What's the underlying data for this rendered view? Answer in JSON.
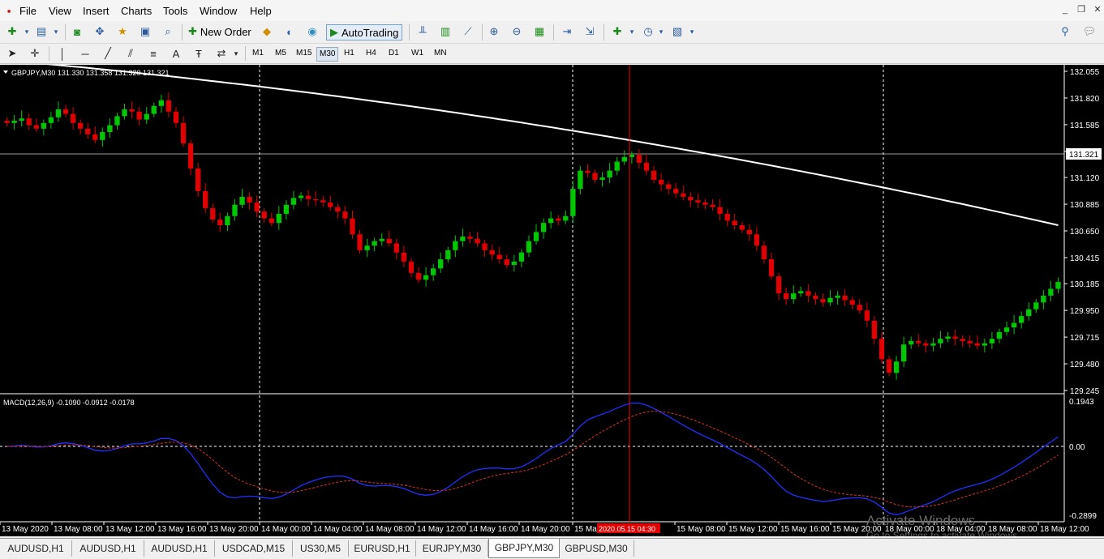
{
  "menu": [
    "File",
    "View",
    "Insert",
    "Charts",
    "Tools",
    "Window",
    "Help"
  ],
  "toolbar": {
    "new_order": "New Order",
    "autotrading": "AutoTrading"
  },
  "timeframes": [
    "M1",
    "M5",
    "M15",
    "M30",
    "H1",
    "H4",
    "D1",
    "W1",
    "MN"
  ],
  "active_timeframe": "M30",
  "chart": {
    "info": "GBPJPY,M30  131.330 131.358 131.320 131.321",
    "current_price": "131.321",
    "price_ticks": [
      "132.055",
      "131.820",
      "131.585",
      "131.350",
      "131.120",
      "130.885",
      "130.650",
      "130.415",
      "130.185",
      "129.950",
      "129.715",
      "129.480",
      "129.245"
    ],
    "time_labels": [
      "13 May 2020",
      "13 May 08:00",
      "13 May 12:00",
      "13 May 16:00",
      "13 May 20:00",
      "14 May 00:00",
      "14 May 04:00",
      "14 May 08:00",
      "14 May 12:00",
      "14 May 16:00",
      "14 May 20:00",
      "15 May",
      "2020.05.15 04:30",
      "15 May 08:00",
      "15 May 12:00",
      "15 May 16:00",
      "15 May 20:00",
      "18 May 00:00",
      "18 May 04:00",
      "18 May 08:00",
      "18 May 12:00"
    ],
    "macd_label": "MACD(12,26,9) -0.1090 -0.0912 -0.0178",
    "macd_ticks": [
      "0.1943",
      "0.00",
      "-0.2899"
    ],
    "watermark_line1": "Activate Windows",
    "watermark_line2": "Go to Settings to activate Windows.",
    "colors": {
      "background": "#000000",
      "bull": "#00c800",
      "bear": "#e00000",
      "ma": "#ffffff",
      "macd": "#2030ff",
      "signal": "#e03020",
      "cursor": "#ff0000"
    }
  },
  "tabs": [
    "AUDUSD,H1",
    "AUDUSD,H1",
    "AUDUSD,H1",
    "USDCAD,M15",
    "US30,M5",
    "EURUSD,H1",
    "EURJPY,M30",
    "GBPJPY,M30",
    "GBPUSD,M30"
  ],
  "active_tab": "GBPJPY,M30",
  "chart_data": {
    "type": "candlestick",
    "symbol": "GBPJPY",
    "timeframe": "M30",
    "ylim": [
      129.245,
      132.055
    ],
    "close_series": [
      131.6,
      131.62,
      131.64,
      131.58,
      131.55,
      131.6,
      131.65,
      131.72,
      131.68,
      131.6,
      131.55,
      131.5,
      131.45,
      131.52,
      131.58,
      131.66,
      131.72,
      131.7,
      131.63,
      131.68,
      131.75,
      131.8,
      131.7,
      131.6,
      131.42,
      131.2,
      131.0,
      130.85,
      130.75,
      130.7,
      130.78,
      130.88,
      130.95,
      130.9,
      130.82,
      130.76,
      130.72,
      130.8,
      130.88,
      130.94,
      130.96,
      130.93,
      130.92,
      130.9,
      130.86,
      130.82,
      130.76,
      130.62,
      130.48,
      130.52,
      130.56,
      130.58,
      130.54,
      130.46,
      130.38,
      130.28,
      130.22,
      130.26,
      130.32,
      130.4,
      130.48,
      130.56,
      130.6,
      130.58,
      130.54,
      130.48,
      130.44,
      130.4,
      130.35,
      130.38,
      130.46,
      130.56,
      130.64,
      130.72,
      130.76,
      130.74,
      130.78,
      131.02,
      131.18,
      131.16,
      131.1,
      131.12,
      131.18,
      131.26,
      131.3,
      131.32,
      131.25,
      131.18,
      131.1,
      131.06,
      131.02,
      130.98,
      130.95,
      130.92,
      130.9,
      130.88,
      130.86,
      130.8,
      130.74,
      130.7,
      130.66,
      130.62,
      130.52,
      130.4,
      130.25,
      130.1,
      130.05,
      130.1,
      130.12,
      130.08,
      130.05,
      130.02,
      130.06,
      130.08,
      130.04,
      130.0,
      129.95,
      129.86,
      129.7,
      129.52,
      129.4,
      129.5,
      129.65,
      129.68,
      129.66,
      129.64,
      129.66,
      129.7,
      129.72,
      129.7,
      129.68,
      129.66,
      129.64,
      129.66,
      129.7,
      129.76,
      129.8,
      129.84,
      129.9,
      129.96,
      130.02,
      130.08,
      130.14,
      130.2
    ]
  }
}
